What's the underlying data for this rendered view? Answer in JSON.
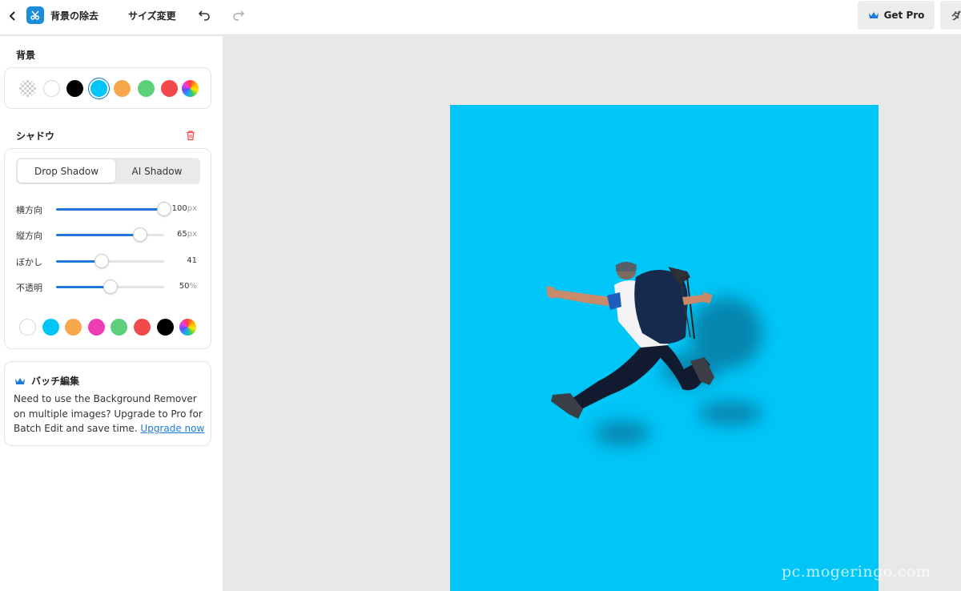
{
  "header": {
    "app_title": "背景の除去",
    "resize_label": "サイズ変更",
    "get_pro_label": "Get Pro",
    "download_label_partial": "ダ"
  },
  "background": {
    "section_title": "背景",
    "swatches": [
      {
        "name": "transparent",
        "color": "checkerboard"
      },
      {
        "name": "white",
        "color": "#ffffff"
      },
      {
        "name": "black",
        "color": "#000000"
      },
      {
        "name": "blue",
        "color": "#00c5f7",
        "selected": true
      },
      {
        "name": "orange",
        "color": "#f7a84a"
      },
      {
        "name": "green",
        "color": "#5ccf7a"
      },
      {
        "name": "red",
        "color": "#f24a4a"
      },
      {
        "name": "rainbow",
        "color": "gradient"
      }
    ]
  },
  "shadow": {
    "section_title": "シャドウ",
    "tabs": {
      "drop": "Drop Shadow",
      "ai": "AI Shadow",
      "active": "Drop Shadow"
    },
    "sliders": [
      {
        "label": "横方向",
        "value": "100",
        "unit": "px",
        "fraction": 1.0
      },
      {
        "label": "縦方向",
        "value": "65",
        "unit": "px",
        "fraction": 0.78
      },
      {
        "label": "ぼかし",
        "value": "41",
        "unit": "",
        "fraction": 0.42
      },
      {
        "label": "不透明",
        "value": "50",
        "unit": "%",
        "fraction": 0.5
      }
    ],
    "swatches": [
      {
        "name": "white",
        "color": "#ffffff"
      },
      {
        "name": "blue",
        "color": "#00c5f7"
      },
      {
        "name": "orange",
        "color": "#f7a84a"
      },
      {
        "name": "magenta",
        "color": "#ee3cb4"
      },
      {
        "name": "green",
        "color": "#5ccf7a"
      },
      {
        "name": "red",
        "color": "#f24a4a"
      },
      {
        "name": "black",
        "color": "#000000"
      },
      {
        "name": "rainbow",
        "color": "gradient"
      }
    ]
  },
  "batch": {
    "title": "バッチ編集",
    "text": "Need to use the Background Remover on multiple images? Upgrade to Pro for Batch Edit and save time.",
    "link": "Upgrade now"
  },
  "canvas": {
    "background_color": "#00c5f7",
    "subject": "jumping hiker with backpack"
  },
  "watermark": "pc.mogeringo.com",
  "colors": {
    "accent": "#1e7ad6",
    "brand_icon": "#1a8ddb"
  }
}
